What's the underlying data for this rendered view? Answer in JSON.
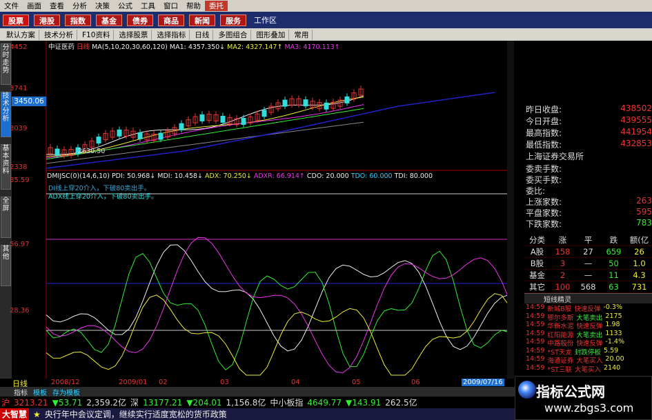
{
  "menu": [
    "文件",
    "画面",
    "查看",
    "分析",
    "决策",
    "公式",
    "工具",
    "窗口",
    "帮助",
    "委托"
  ],
  "nav": [
    "股票",
    "港股",
    "指数",
    "基金",
    "债券",
    "商品",
    "新闻",
    "服务"
  ],
  "nav_extra": "工作区",
  "toolbar": [
    "默认方案",
    "技术分析",
    "F10资料",
    "选择股票",
    "选择指标",
    "日线",
    "多图组合",
    "图形叠加",
    "常用"
  ],
  "left_tabs": [
    "分时走势",
    "技术分析",
    "基本资料",
    "全屏",
    "其他"
  ],
  "kline_header": {
    "name": "中证医药",
    "period": "日线",
    "ma": "MA(5,10,20,30,60,120)",
    "ma1": "MA1: 4357.350↓",
    "ma2": "MA2: 4327.147↑",
    "ma3": "MA3: 4170.113↑"
  },
  "price_axis": [
    "4452",
    "3741",
    "3039",
    "2338"
  ],
  "current_price": "3450.06",
  "low_mark": "2630.50",
  "dmi_header": {
    "name": "DMIJSC(0)(14,6,10)",
    "pdi": "PDI: 50.968↓",
    "mdi": "MDI: 10.458↓",
    "adx": "ADX: 70.250↓",
    "adxr": "ADXR: 66.914↑",
    "cdo": "CDO: 20.000",
    "tdo": "TDO: 60.000",
    "tdi": "TDI: 80.000"
  },
  "dmi_notes": [
    "DI线上穿20介入，下破80卖出手。",
    "ADX线上穿20介入，下破80卖出手。"
  ],
  "dmi_axis": [
    "85.59",
    "56.97",
    "28.36"
  ],
  "right_panel": {
    "rows": [
      {
        "label": "昨日收盘:",
        "value": "438502"
      },
      {
        "label": "今日开盘:",
        "value": "439555"
      },
      {
        "label": "最高指数:",
        "value": "441954"
      },
      {
        "label": "最低指数:",
        "value": "432853"
      }
    ],
    "exchange": "上海证券交易所",
    "rows2": [
      {
        "label": "委卖手数:",
        "value": ""
      },
      {
        "label": "委买手数:",
        "value": ""
      },
      {
        "label": "委比:",
        "value": ""
      },
      {
        "label": "上涨家数:",
        "value": "263"
      },
      {
        "label": "平盘家数:",
        "value": "595"
      },
      {
        "label": "下跌家数:",
        "value": "783"
      }
    ]
  },
  "stats": {
    "headers": [
      "分类",
      "涨",
      "平",
      "跌",
      "额(亿"
    ],
    "rows": [
      [
        "A股",
        "158",
        "27",
        "659",
        "26"
      ],
      [
        "B股",
        "3",
        "—",
        "50",
        "1.0"
      ],
      [
        "基金",
        "2",
        "—",
        "11",
        "4.3"
      ],
      [
        "其它",
        "100",
        "568",
        "63",
        "731"
      ]
    ]
  },
  "sprite": {
    "title": "短线精灵",
    "rows": [
      {
        "time": "14:59",
        "name": "新城B股",
        "signal": "快速反弹",
        "val": "-0.3%",
        "up": true
      },
      {
        "time": "14:59",
        "name": "鄂尔多斯",
        "signal": "大笔卖出",
        "val": "2175",
        "up": false
      },
      {
        "time": "14:59",
        "name": "华新水泥",
        "signal": "快速反弹",
        "val": "1.98",
        "up": true
      },
      {
        "time": "14:59",
        "name": "红阳能源",
        "signal": "大笔卖出",
        "val": "1133",
        "up": false
      },
      {
        "time": "14:59",
        "name": "中路股份",
        "signal": "快速反弹",
        "val": "-1.4%",
        "up": true
      },
      {
        "time": "14:59",
        "name": "*ST天龙",
        "signal": "封跌停板",
        "val": "5.59",
        "up": false
      },
      {
        "time": "14:59",
        "name": "海通证券",
        "signal": "大笔买入",
        "val": "20.00",
        "up": true
      },
      {
        "time": "14:59",
        "name": "*ST三联",
        "signal": "大笔买入",
        "val": "2140",
        "up": true
      }
    ]
  },
  "date_axis": [
    "2008/12",
    "2009/01",
    "02",
    "03",
    "04",
    "05",
    "06",
    "2009/07/16"
  ],
  "period_tab": "日线",
  "tab_row": [
    "指标",
    "模板",
    "存为模板"
  ],
  "ticker": {
    "sh_label": "沪",
    "sh_price": "3213.21",
    "sh_change": "▼53.71",
    "sh_amount": "2,359.2亿",
    "sz_label": "深",
    "sz_price": "13177.21",
    "sz_change": "▼204.01",
    "sz_amount": "1,156.8亿",
    "small_label": "中小板指",
    "small_price": "4649.77",
    "small_change": "▼143.91",
    "small_amount": "262.5亿"
  },
  "news": {
    "brand": "大智慧",
    "text": "央行年中会议定调，继续实行适度宽松的货币政策"
  },
  "watermark": {
    "line1": "指标公式网",
    "line2": "www.zbgs3.com"
  },
  "colors": {
    "up": "#e33333",
    "down": "#33e333",
    "accent": "#1c6fd1"
  }
}
